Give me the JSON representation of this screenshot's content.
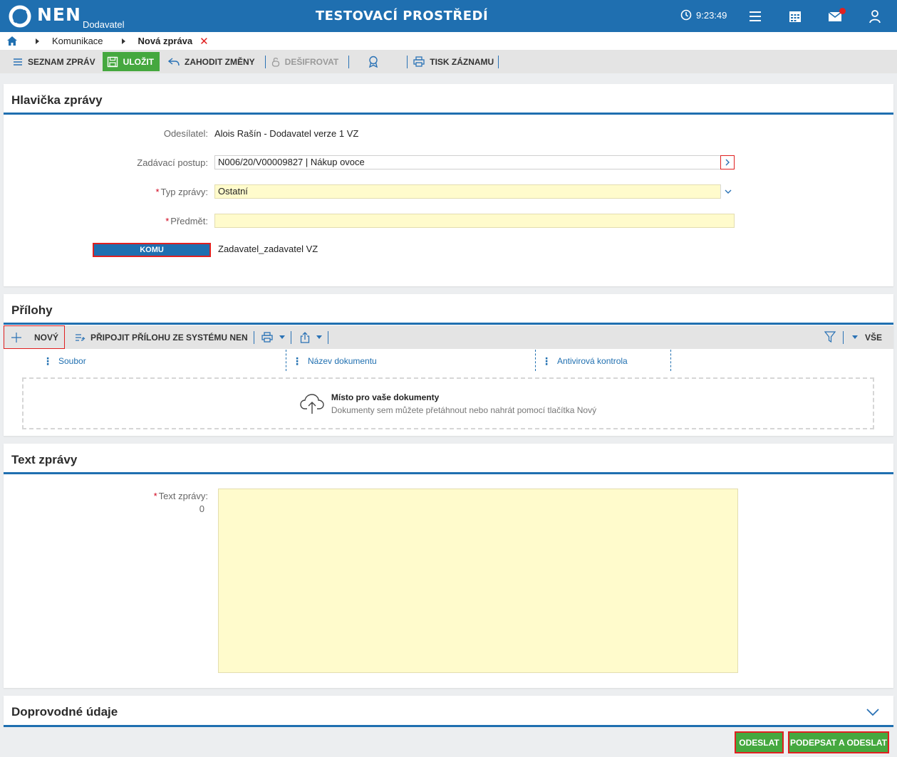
{
  "app": {
    "logo_text": "NEN",
    "logo_sub": "Dodavatel",
    "environment_title": "TESTOVACÍ PROSTŘEDÍ",
    "clock_time": "9:23:49",
    "accent_color": "#1f6fb0",
    "success_color": "#45a83f"
  },
  "breadcrumb": {
    "items": [
      "Komunikace",
      "Nová zpráva"
    ],
    "close_glyph": "✕"
  },
  "toolbar": {
    "list_label": "SEZNAM ZPRÁV",
    "save_label": "ULOŽIT",
    "discard_label": "ZAHODIT ZMĚNY",
    "decrypt_label": "DEŠIFROVAT",
    "print_label": "TISK ZÁZNAMU"
  },
  "header_section": {
    "title": "Hlavička zprávy",
    "sender_label": "Odesílatel:",
    "sender_value": "Alois Rašín - Dodavatel verze 1 VZ",
    "procedure_label": "Zadávací postup:",
    "procedure_value": "N006/20/V00009827 | Nákup ovoce",
    "type_label": "Typ zprávy:",
    "type_value": "Ostatní",
    "subject_label": "Předmět:",
    "subject_value": "",
    "recipient_button": "KOMU",
    "recipient_value": "Zadavatel_zadavatel VZ",
    "required_mark": "*"
  },
  "attachments": {
    "title": "Přílohy",
    "new_label": "NOVÝ",
    "attach_system_label": "PŘIPOJIT PŘÍLOHU ZE SYSTÉMU NEN",
    "filter_all_label": "VŠE",
    "columns": [
      "Soubor",
      "Název dokumentu",
      "Antivirová kontrola"
    ],
    "dropzone_title": "Místo pro vaše dokumenty",
    "dropzone_sub": "Dokumenty sem můžete přetáhnout nebo nahrát pomocí tlačítka Nový"
  },
  "text_section": {
    "title": "Text zprávy",
    "label": "Text zprávy:",
    "char_count": "0",
    "value": ""
  },
  "extra_section": {
    "title": "Doprovodné údaje"
  },
  "footer": {
    "send_label": "ODESLAT",
    "sign_send_label": "PODEPSAT A ODESLAT"
  }
}
